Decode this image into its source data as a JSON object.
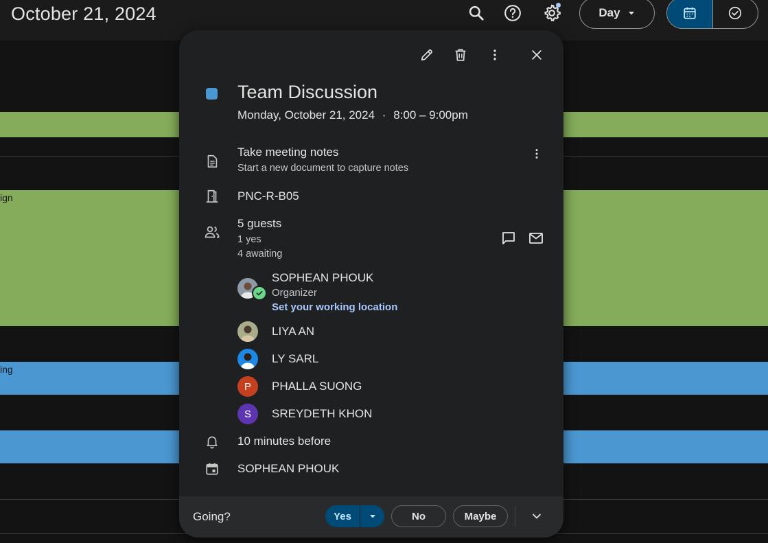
{
  "header": {
    "date_title": "October 21, 2024",
    "view_label": "Day",
    "icons": [
      "search-icon",
      "help-icon",
      "settings-icon",
      "calendar-view-icon",
      "tasks-view-icon"
    ]
  },
  "background": {
    "event_fragments": [
      "ign",
      "ing"
    ]
  },
  "event": {
    "title": "Team Discussion",
    "date": "Monday, October 21, 2024",
    "separator": "·",
    "time": "8:00 – 9:00pm",
    "color": "#4b97d2",
    "notes_link": "Take meeting notes",
    "notes_sub": "Start a new document to capture notes",
    "room": "PNC-R-B05",
    "guests_count": "5 guests",
    "guests_yes": "1 yes",
    "guests_awaiting": "4 awaiting",
    "guests": [
      {
        "name": "SOPHEAN PHOUK",
        "role": "Organizer",
        "link": "Set your working location"
      },
      {
        "name": "LIYA AN"
      },
      {
        "name": "LY SARL"
      },
      {
        "name": "PHALLA SUONG",
        "initial": "P",
        "color": "#c5401f"
      },
      {
        "name": "SREYDETH KHON",
        "initial": "S",
        "color": "#5e35b1"
      }
    ],
    "reminder": "10 minutes before",
    "calendar_owner": "SOPHEAN PHOUK"
  },
  "footer": {
    "going_label": "Going?",
    "yes_label": "Yes",
    "no_label": "No",
    "maybe_label": "Maybe"
  }
}
